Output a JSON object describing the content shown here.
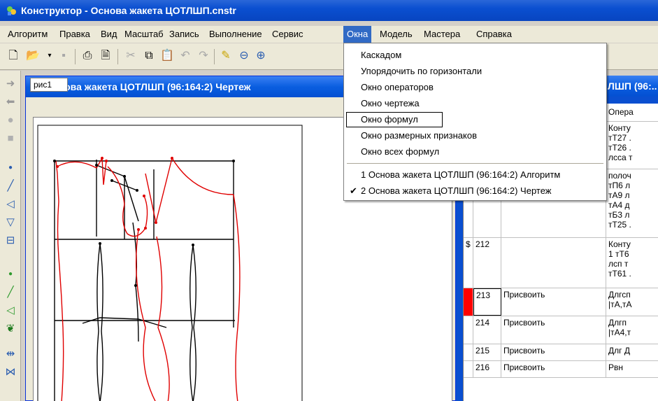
{
  "window": {
    "title": "Конструктор - Основа жакета ЦОТЛШП.cnstr"
  },
  "menubar": {
    "items": [
      "Алгоритм",
      "Правка",
      "Вид",
      "Масштаб",
      "Запись",
      "Выполнение",
      "Сервис",
      "Окна",
      "Модель",
      "Мастера",
      "Справка"
    ],
    "active": "Окна"
  },
  "windows_menu": {
    "items": [
      {
        "label": "Каскадом",
        "checked": false
      },
      {
        "label": "Упорядочить по горизонтали",
        "checked": false
      },
      {
        "label": "Окно операторов",
        "checked": false
      },
      {
        "label": "Окно чертежа",
        "checked": false
      },
      {
        "label": "Окно формул",
        "checked": false,
        "hovered": true
      },
      {
        "label": "Окно размерных признаков",
        "checked": false
      },
      {
        "label": "Окно всех формул",
        "checked": false
      }
    ],
    "window_list": [
      {
        "label": "1 Основа жакета ЦОТЛШП (96:164:2) Алгоритм",
        "checked": false
      },
      {
        "label": "2 Основа жакета ЦОТЛШП (96:164:2) Чертеж",
        "checked": true
      }
    ]
  },
  "drawing_window": {
    "title": "Основа жакета ЦОТЛШП (96:164:2) Чертеж",
    "tab": "рис1"
  },
  "algorithm_window": {
    "title_fragment": "ЛШП (96:..",
    "header_fragment": "Опера",
    "rows": [
      {
        "mark": "",
        "num": "",
        "op": "",
        "text": [
          "Конту",
          "тТ27 .",
          "тТ26 .",
          "лсса т"
        ],
        "red": false
      },
      {
        "mark": "",
        "num": "",
        "op": "",
        "text": [
          "полоч",
          "тП6 л",
          "тА9 л",
          "тА4 д",
          "тБ3 л",
          "тТ25 ."
        ],
        "red": false
      },
      {
        "mark": "$",
        "num": "212",
        "op": "",
        "text": [
          "Конту",
          "1 тТ6",
          "лсп т",
          "тТ61 ."
        ],
        "red": false
      },
      {
        "mark": "",
        "num": "213",
        "op": "Присвоить",
        "text": [
          "Длгсп",
          "|тА,тА"
        ],
        "red": true
      },
      {
        "mark": "",
        "num": "214",
        "op": "Присвоить",
        "text": [
          "Длгп",
          "|тА4,т"
        ],
        "red": false
      },
      {
        "mark": "",
        "num": "215",
        "op": "Присвоить",
        "text": [
          "Длг Д"
        ],
        "red": false
      },
      {
        "mark": "",
        "num": "216",
        "op": "Присвоить",
        "text": [
          "Рвн"
        ],
        "red": false
      }
    ]
  },
  "colors": {
    "title_blue": "#0a4fd0",
    "menu_highlight": "#316ac5",
    "pattern_red": "#e00000",
    "pattern_black": "#000000",
    "selected_cell_red": "#ff0000"
  }
}
